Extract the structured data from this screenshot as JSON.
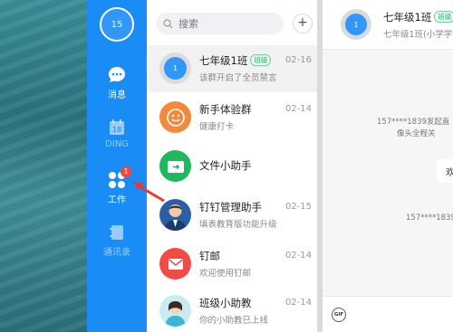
{
  "rail": {
    "avatar_text": "15",
    "items": [
      {
        "label": "消息"
      },
      {
        "label": "DING"
      },
      {
        "label": "工作",
        "badge": "1"
      },
      {
        "label": "通讯录"
      }
    ]
  },
  "search": {
    "placeholder": "搜索"
  },
  "add_button": "+",
  "chats": [
    {
      "name": "七年级1班",
      "tag": "班级",
      "preview": "该群开启了全员禁言",
      "time": "02-16",
      "avatar_text": "1",
      "avatar_color": "#3296fa"
    },
    {
      "name": "新手体验群",
      "tag": "",
      "preview": "健康打卡",
      "time": "02-14",
      "avatar_color": "#f08a3c"
    },
    {
      "name": "文件小助手",
      "tag": "",
      "preview": "",
      "time": "",
      "avatar_color": "#1fb85e"
    },
    {
      "name": "钉钉管理助手",
      "tag": "",
      "preview": "填表教育版功能升级",
      "time": "02-15",
      "avatar_color": "#2a5fa8"
    },
    {
      "name": "钉邮",
      "tag": "",
      "preview": "欢迎使用钉邮",
      "time": "02-14",
      "avatar_color": "#f04b45"
    },
    {
      "name": "班级小助教",
      "tag": "",
      "preview": "你的小助教已上线",
      "time": "02-14",
      "avatar_color": "#38b7d6"
    }
  ],
  "conversation": {
    "title": "七年级1班",
    "tag": "班级",
    "subtitle": "七年级1班(小学学",
    "avatar_text": "1",
    "system_message_1a": "157****1839发起直",
    "system_message_1b": "像头全程关",
    "bubble_text": "欢",
    "system_message_2": "157****1839",
    "footer_icon": "GIF"
  }
}
